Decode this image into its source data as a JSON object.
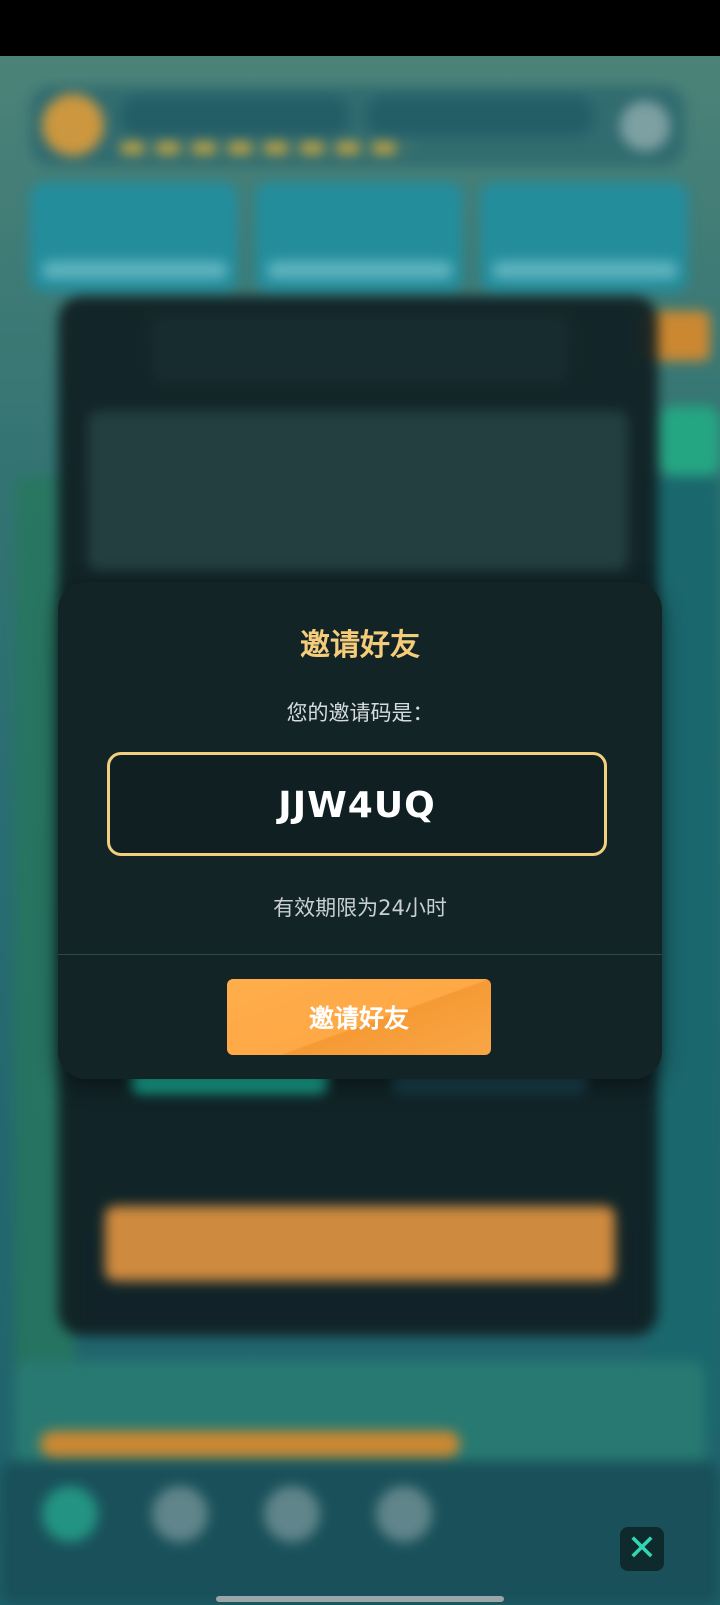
{
  "dialog": {
    "title": "邀请好友",
    "subtitle": "您的邀请码是：",
    "invite_code": "JJW4UQ",
    "validity": "有效期限为24小时",
    "button_label": "邀请好友"
  },
  "close_button": {
    "glyph": "✕"
  },
  "colors": {
    "title": "#f5cc7a",
    "code_border": "#f2cf7e",
    "button": "#ffa846",
    "dialog_bg": "#132427"
  },
  "icons": [
    "close-icon",
    "home-tab-icon",
    "shield-tab-icon",
    "gear-tab-icon",
    "heart-tab-icon"
  ]
}
